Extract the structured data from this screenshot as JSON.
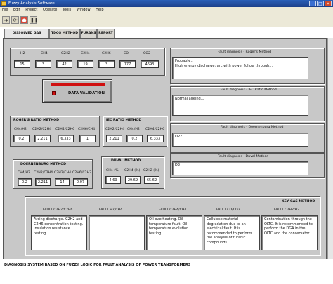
{
  "window": {
    "title": "Fuzzy Analysis Software",
    "min": "_",
    "max": "□",
    "close": "×"
  },
  "menu": [
    "File",
    "Edit",
    "Project",
    "Operate",
    "Tools",
    "Window",
    "Help"
  ],
  "tabs": [
    {
      "label": "DISSOLVED GAS ANALYSIS",
      "active": true
    },
    {
      "label": "TDCG METHOD",
      "active": false
    },
    {
      "label": "FURANS",
      "active": false
    },
    {
      "label": "REPORT",
      "active": false
    }
  ],
  "gases": [
    {
      "label": "H2",
      "value": "15"
    },
    {
      "label": "CH4",
      "value": "3"
    },
    {
      "label": "C2H2",
      "value": "42"
    },
    {
      "label": "C2H4",
      "value": "19"
    },
    {
      "label": "C2H6",
      "value": "3"
    },
    {
      "label": "CO",
      "value": "177"
    },
    {
      "label": "CO2",
      "value": "4693"
    }
  ],
  "data_validation": {
    "label": "DATA VALIDATION"
  },
  "rogers": {
    "title": "ROGER'S RATIO METHOD",
    "ratios": [
      {
        "label": "CH4/H2",
        "value": "0.2"
      },
      {
        "label": "C2H2/C2H4",
        "value": "2.211"
      },
      {
        "label": "C2H4/C2H6",
        "value": "6.333"
      },
      {
        "label": "C2H6/CH4",
        "value": "1"
      }
    ]
  },
  "iec": {
    "title": "IEC RATIO METHOD",
    "ratios": [
      {
        "label": "C2H2/C2H4",
        "value": "2.211"
      },
      {
        "label": "CH4/H2",
        "value": "0.2"
      },
      {
        "label": "C2H4/C2H6",
        "value": "6.333"
      }
    ]
  },
  "doernenburg": {
    "title": "DOERNENBURG METHOD",
    "ratios": [
      {
        "label": "CH4/H2",
        "value": "0.2"
      },
      {
        "label": "C2H2/C2H4",
        "value": "2.211"
      },
      {
        "label": "C2H2/CH4",
        "value": "14"
      },
      {
        "label": "C2H6/C2H2",
        "value": "0.07"
      }
    ]
  },
  "duval": {
    "title": "DUVAL METHOD",
    "ratios": [
      {
        "label": "CH4 (%)",
        "value": "4.69"
      },
      {
        "label": "C2H4 (%)",
        "value": "29.69"
      },
      {
        "label": "C2H2 (%)",
        "value": "65.62"
      }
    ]
  },
  "diagnosis": {
    "rogers": {
      "title": "Fault diagnosis - Roger's Method",
      "text": "Probably...\nHigh energy discharge: arc with power follow through..."
    },
    "iec": {
      "title": "Fault diagnosis - IEC Ratio Method",
      "text": "Normal ageing..."
    },
    "doernenburg": {
      "title": "Fault diagnosis - Doernenburg Method",
      "text": "DP2"
    },
    "duval": {
      "title": "Fault diagnosis - Duval Method",
      "text": "D2"
    }
  },
  "key_gas": {
    "title": "KEY GAS METHOD",
    "faults": [
      {
        "label": "FAULT  C2H2/C2H6",
        "text": "Arcing discharge. C2H2 and C2H6 concentration testing. Insulation resistance testing."
      },
      {
        "label": "FAULT  H2/CH4",
        "text": ""
      },
      {
        "label": "FAULT  C2H4/CH4",
        "text": "Oil overheating. Oil temperature fault. Oil temperature evolution testing."
      },
      {
        "label": "FAULT  CO/CO2",
        "text": "Cellulose material degradation due to an electrical fault. It is recommended to perform the analysis of furanic compounds."
      },
      {
        "label": "FAULT  C2H2/H2",
        "text": "Contamination through the OLTC. It is recommended to perform the DGA in the OLTC and the conservator."
      }
    ]
  },
  "status": "DIAGNOSIS SYSTEM BASED ON FUZZY LOGIC FOR FAULT ANALYSIS OF POWER TRANSFORMERS",
  "colors": {
    "panel": "#c8c8c8",
    "led": "#d01010",
    "titlebar": "#1c3f8a"
  }
}
